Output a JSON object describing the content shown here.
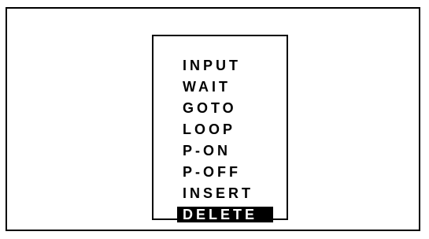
{
  "menu": {
    "items": [
      {
        "label": "INPUT"
      },
      {
        "label": "WAIT"
      },
      {
        "label": "GOTO"
      },
      {
        "label": "LOOP"
      },
      {
        "label": "P-ON"
      },
      {
        "label": "P-OFF"
      },
      {
        "label": "INSERT"
      },
      {
        "label": "DELETE"
      }
    ],
    "selected_label": "DELETE"
  },
  "colors": {
    "background": "#ffffff",
    "foreground": "#000000",
    "highlight_background": "#000000",
    "highlight_text": "#ffffff"
  }
}
